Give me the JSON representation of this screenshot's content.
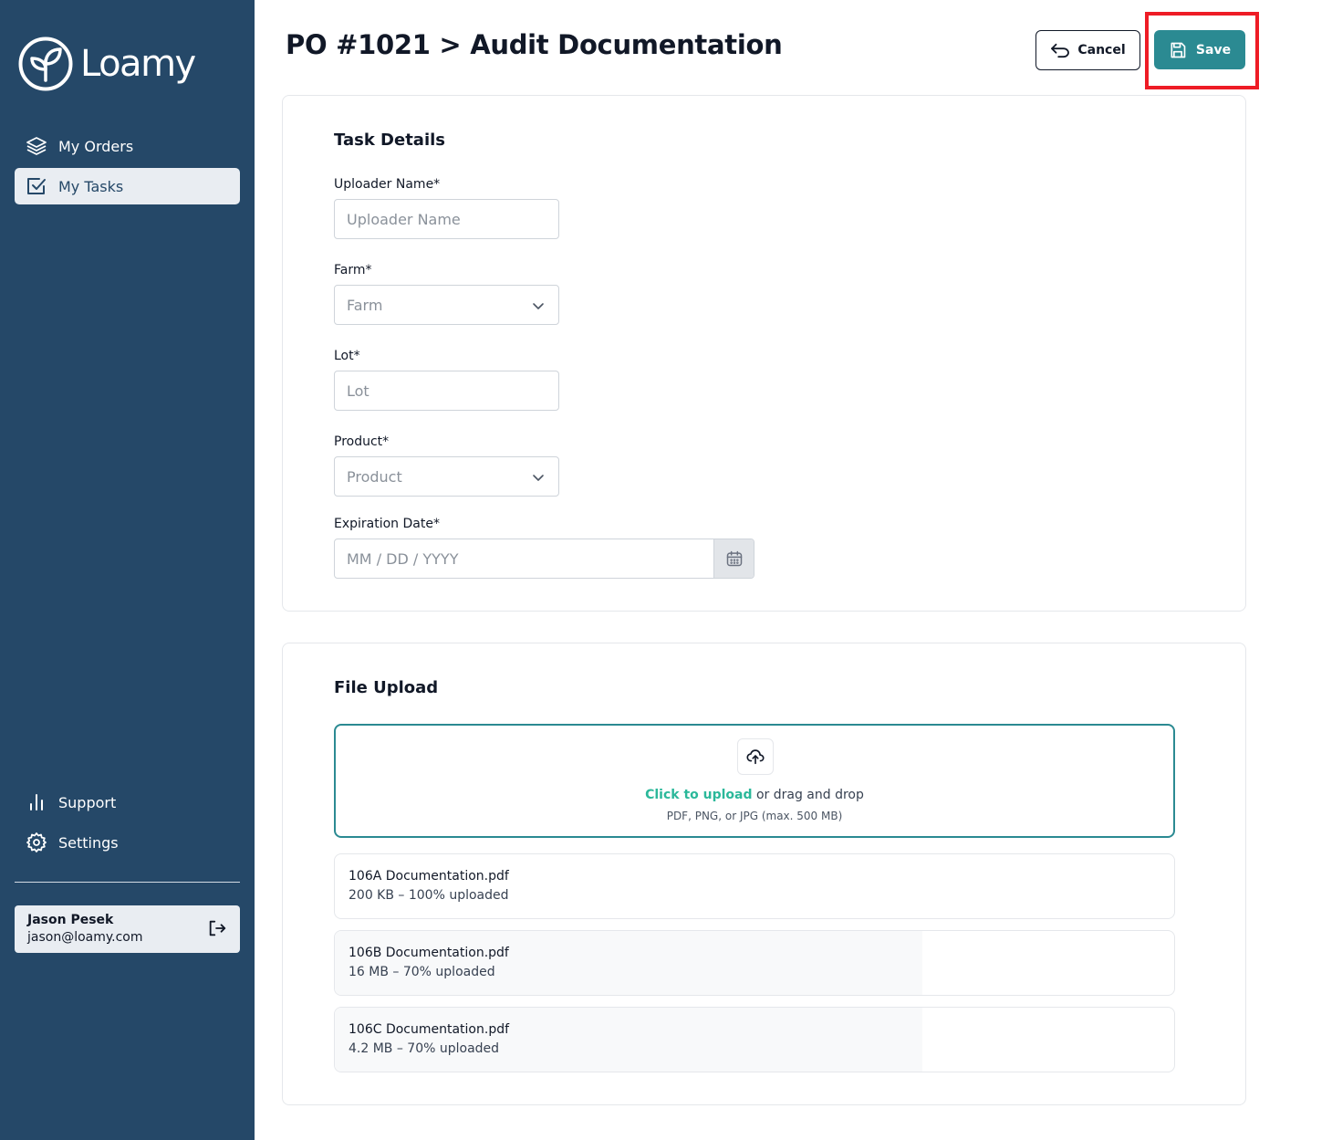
{
  "app": {
    "name": "Loamy"
  },
  "sidebar": {
    "nav": [
      {
        "label": "My Orders",
        "icon": "layers-icon",
        "active": false
      },
      {
        "label": "My Tasks",
        "icon": "checkbox-icon",
        "active": true
      }
    ],
    "bottom_nav": [
      {
        "label": "Support",
        "icon": "bar-chart-icon"
      },
      {
        "label": "Settings",
        "icon": "gear-icon"
      }
    ],
    "user": {
      "name": "Jason Pesek",
      "email": "jason@loamy.com"
    }
  },
  "header": {
    "breadcrumb_parent": "PO #1021",
    "breadcrumb_separator": ">",
    "title": "Audit Documentation",
    "cancel_label": "Cancel",
    "save_label": "Save"
  },
  "task_details": {
    "title": "Task Details",
    "fields": {
      "uploader": {
        "label": "Uploader Name*",
        "placeholder": "Uploader Name"
      },
      "farm": {
        "label": "Farm*",
        "placeholder": "Farm"
      },
      "lot": {
        "label": "Lot*",
        "placeholder": "Lot"
      },
      "product": {
        "label": "Product*",
        "placeholder": "Product"
      },
      "expiration": {
        "label": "Expiration Date*",
        "placeholder": "MM / DD / YYYY"
      }
    }
  },
  "file_upload": {
    "title": "File Upload",
    "link_text": "Click to upload",
    "drop_text": " or drag and drop",
    "hint": "PDF, PNG, or JPG (max. 500 MB)",
    "files": [
      {
        "name": "106A Documentation.pdf",
        "meta": "200 KB – 100% uploaded",
        "progress": 1.0
      },
      {
        "name": "106B Documentation.pdf",
        "meta": "16 MB – 70% uploaded",
        "progress": 0.7
      },
      {
        "name": "106C Documentation.pdf",
        "meta": "4.2 MB – 70% uploaded",
        "progress": 0.7
      }
    ]
  },
  "colors": {
    "sidebar": "#254868",
    "accent": "#2b8a92",
    "link": "#2bb89a",
    "annotation": "#ee1c25"
  }
}
